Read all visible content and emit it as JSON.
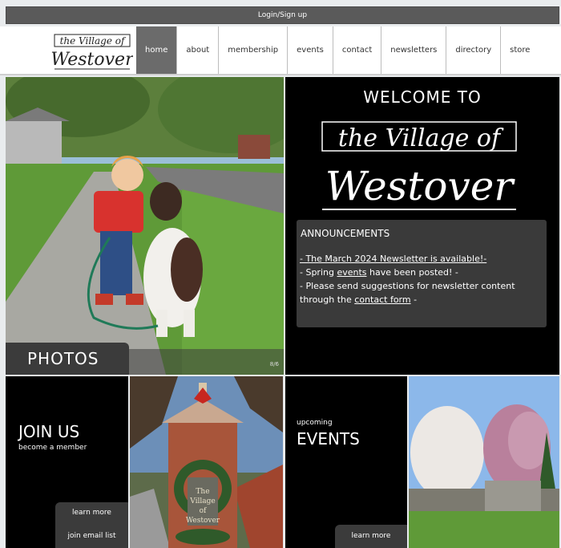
{
  "topbar": {
    "login_label": "Login/Sign up"
  },
  "nav": {
    "items": [
      "home",
      "about",
      "membership",
      "events",
      "contact",
      "newsletters",
      "directory",
      "store"
    ],
    "active": "home"
  },
  "photos": {
    "label": "PHOTOS",
    "counter": "8/6"
  },
  "welcome": {
    "title": "WELCOME TO",
    "announcements_title": "ANNOUNCEMENTS",
    "line1": "- The March 2024 Newsletter is available!-",
    "line2_prefix": "- Spring ",
    "line2_link": "events",
    "line2_suffix": " have been posted! -",
    "line3": "- Please send suggestions for newsletter content",
    "line4_prefix": "through the ",
    "line4_link": "contact form",
    "line4_suffix": " -"
  },
  "join": {
    "title": "JOIN US",
    "subtitle": "become a member",
    "learn_more": "learn more",
    "email_list": "join email list"
  },
  "events": {
    "small_label": "upcoming",
    "title": "EVENTS",
    "learn_more": "learn more"
  },
  "colors": {
    "tile_dark": "#000000",
    "button_gray": "#3b3b3b",
    "nav_active": "#6b6b6b"
  }
}
